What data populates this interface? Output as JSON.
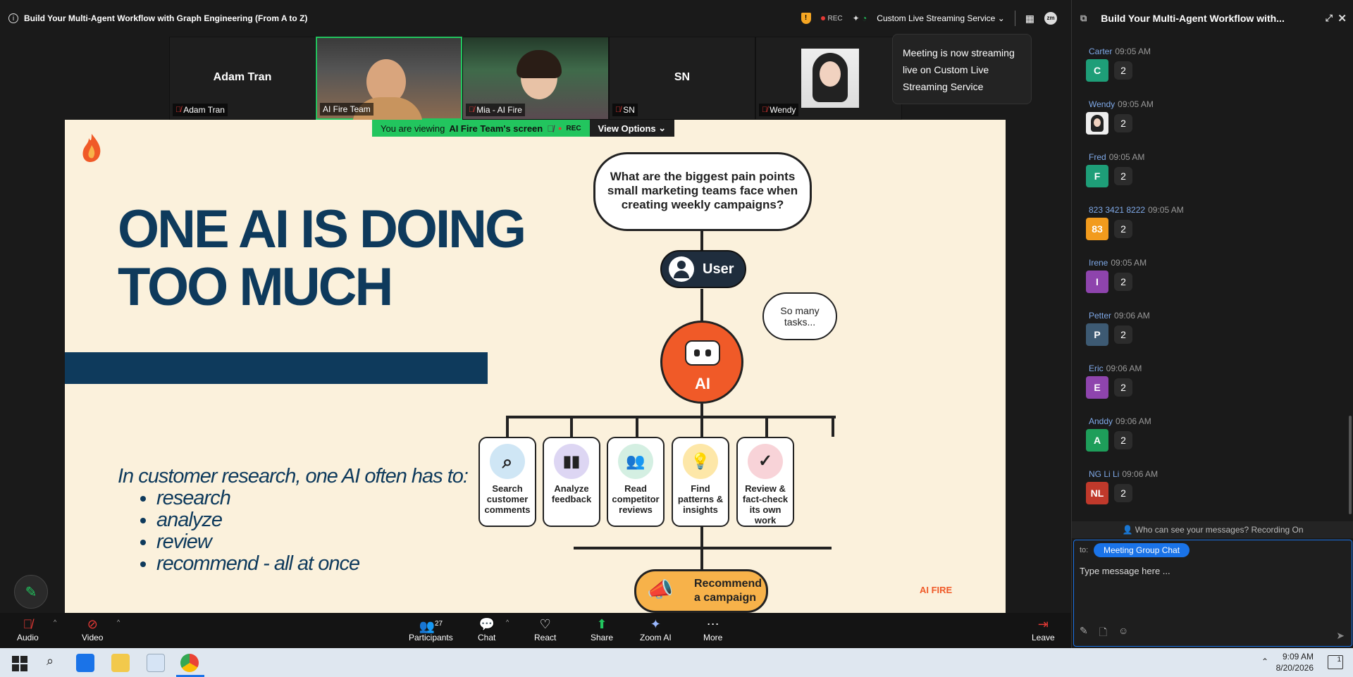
{
  "window": {
    "title": "Build Your Multi-Agent Workflow with Graph Engineering (From A to Z)",
    "rec": "REC",
    "stream_label": "Custom Live Streaming Service"
  },
  "toast": "Meeting is now streaming live on Custom Live Streaming Service",
  "participants": [
    {
      "display": "Adam Tran",
      "label": "Adam Tran"
    },
    {
      "display": "",
      "label": "AI Fire Team"
    },
    {
      "display": "",
      "label": "Mia - AI Fire"
    },
    {
      "display": "SN",
      "label": "SN"
    },
    {
      "display": "",
      "label": "Wendy"
    }
  ],
  "viewing": {
    "prefix": "You are viewing",
    "screen": "AI Fire Team's screen",
    "rec": "REC",
    "options": "View Options"
  },
  "slide": {
    "headline_1": "ONE AI IS DOING",
    "headline_2": "TOO MUCH",
    "intro": "In customer research, one AI often has to:",
    "bullets": [
      "research",
      "analyze",
      "review",
      "recommend - all at once"
    ],
    "question": "What are the biggest pain points small marketing teams face when creating weekly campaigns?",
    "user": "User",
    "ai": "AI",
    "thought": "So many tasks...",
    "cards": [
      {
        "label": "Search customer comments",
        "color": "#cfe6f5"
      },
      {
        "label": "Analyze feedback",
        "color": "#ddd6f3"
      },
      {
        "label": "Read competitor reviews",
        "color": "#d4efe2"
      },
      {
        "label": "Find patterns & insights",
        "color": "#fde7a8"
      },
      {
        "label": "Review & fact-check its own work",
        "color": "#f8d3d8"
      }
    ],
    "campaign": "Recommend a campaign",
    "brand": "AI FIRE"
  },
  "toolbar": {
    "audio": "Audio",
    "video": "Video",
    "participants": "Participants",
    "participants_count": "27",
    "chat": "Chat",
    "react": "React",
    "share": "Share",
    "zoom_ai": "Zoom AI",
    "more": "More",
    "leave": "Leave"
  },
  "chat": {
    "title": "Build Your Multi-Agent Workflow with...",
    "messages": [
      {
        "name": "Carter",
        "time": "09:05 AM",
        "initials": "C",
        "color": "#1e9e78",
        "text": "2"
      },
      {
        "name": "Wendy",
        "time": "09:05 AM",
        "initials": "",
        "color": "#ddd",
        "text": "2"
      },
      {
        "name": "Fred",
        "time": "09:05 AM",
        "initials": "F",
        "color": "#1e9e78",
        "text": "2"
      },
      {
        "name": "823 3421 8222",
        "time": "09:05 AM",
        "initials": "83",
        "color": "#f29b1d",
        "text": "2"
      },
      {
        "name": "Irene",
        "time": "09:05 AM",
        "initials": "I",
        "color": "#8e44ad",
        "text": "2"
      },
      {
        "name": "Petter",
        "time": "09:06 AM",
        "initials": "P",
        "color": "#3d5a73",
        "text": "2"
      },
      {
        "name": "Eric",
        "time": "09:06 AM",
        "initials": "E",
        "color": "#8e44ad",
        "text": "2"
      },
      {
        "name": "Anddy",
        "time": "09:06 AM",
        "initials": "A",
        "color": "#1e9e5a",
        "text": "2"
      },
      {
        "name": "NG Li Li",
        "time": "09:06 AM",
        "initials": "NL",
        "color": "#c0392b",
        "text": "2"
      }
    ],
    "who_can_see": "Who can see your messages? Recording On",
    "to_label": "to:",
    "recipient": "Meeting Group Chat",
    "placeholder": "Type message here ..."
  },
  "taskbar": {
    "time": "9:09 AM",
    "date": "8/20/2026",
    "notif": "1"
  }
}
